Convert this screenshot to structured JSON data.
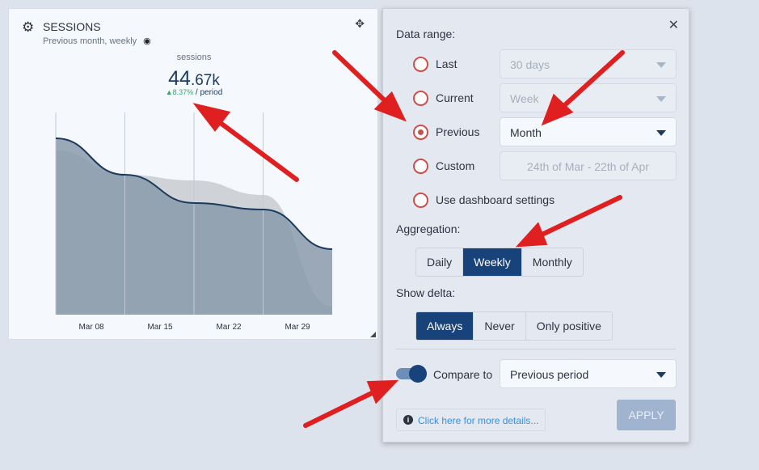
{
  "widget": {
    "title": "SESSIONS",
    "subtitle": "Previous month, weekly",
    "metric_label": "sessions",
    "metric_int": "44",
    "metric_dec": ".67k",
    "delta": "▲8.37%",
    "delta_suffix": " / period"
  },
  "chart_data": {
    "type": "area",
    "categories": [
      "Mar 08",
      "Mar 15",
      "Mar 22",
      "Mar 29"
    ],
    "x": [
      "Mar 01",
      "Mar 08",
      "Mar 15",
      "Mar 22",
      "Mar 29"
    ],
    "series": [
      {
        "role": "current",
        "color": "#8a9aab",
        "line": "#1b3a5e",
        "values": [
          218,
          173,
          138,
          130,
          81
        ]
      },
      {
        "role": "compare",
        "color": "#cfd3d8",
        "values": [
          203,
          173,
          166,
          148,
          10
        ]
      }
    ],
    "grid": true
  },
  "panel": {
    "data_range_label": "Data range:",
    "ranges": [
      {
        "label": "Last",
        "value": "30 days",
        "selected": false,
        "disabled": true
      },
      {
        "label": "Current",
        "value": "Week",
        "selected": false,
        "disabled": true
      },
      {
        "label": "Previous",
        "value": "Month",
        "selected": true,
        "disabled": false
      },
      {
        "label": "Custom",
        "value": "24th of Mar - 22th of Apr",
        "selected": false,
        "disabled": true
      }
    ],
    "dashboard_label": "Use dashboard settings",
    "aggregation_label": "Aggregation:",
    "aggregation": [
      "Daily",
      "Weekly",
      "Monthly"
    ],
    "aggregation_active": "Weekly",
    "delta_label": "Show delta:",
    "delta": [
      "Always",
      "Never",
      "Only positive"
    ],
    "delta_active": "Always",
    "compare_label": "Compare to",
    "compare_on": true,
    "compare_value": "Previous period",
    "details_link": "Click here for more details...",
    "apply": "APPLY"
  },
  "colors": {
    "accent": "#17437a",
    "radio": "#c9504c",
    "positive": "#3aa66a",
    "annotation_arrow": "#e02020"
  }
}
